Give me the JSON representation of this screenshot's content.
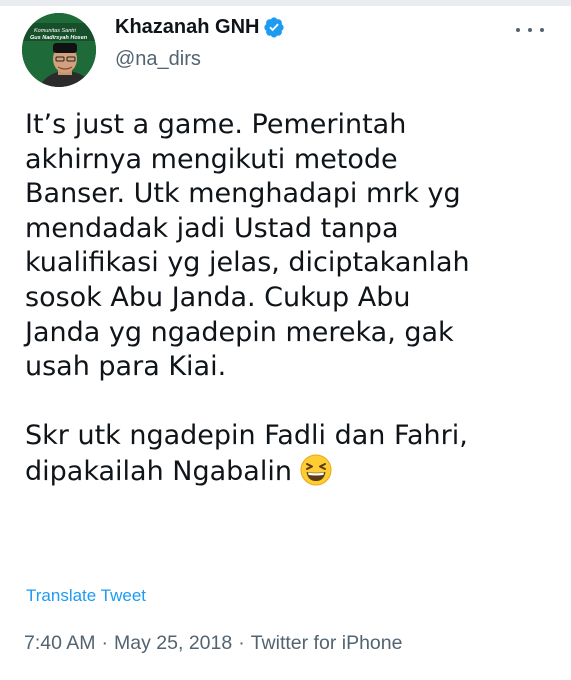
{
  "author": {
    "display_name": "Khazanah GNH",
    "handle": "@na_dirs",
    "avatar_banner_text": "Komunitas Santri Gus Nadirsyah Hosen",
    "verified": true
  },
  "tweet": {
    "lines": [
      "It’s just a game. Pemerintah",
      "akhirnya mengikuti metode",
      "Banser. Utk menghadapi mrk yg",
      "mendadak jadi Ustad tanpa",
      "kualifikasi yg jelas, diciptakanlah",
      "sosok Abu Janda. Cukup Abu",
      "Janda yg ngadepin mereka, gak",
      "usah para Kiai."
    ],
    "lines_2": [
      "Skr utk ngadepin Fadli dan Fahri,"
    ],
    "last_line": "dipakailah Ngabalin",
    "emoji": "grinning-squinting-face-emoji"
  },
  "translate_label": "Translate Tweet",
  "meta": {
    "time": "7:40 AM",
    "date": "May 25, 2018",
    "source": "Twitter for iPhone",
    "separator": "·"
  },
  "colors": {
    "text": "#0f1419",
    "secondary": "#536471",
    "link": "#1d9bf0",
    "verified": "#1d9bf0"
  }
}
